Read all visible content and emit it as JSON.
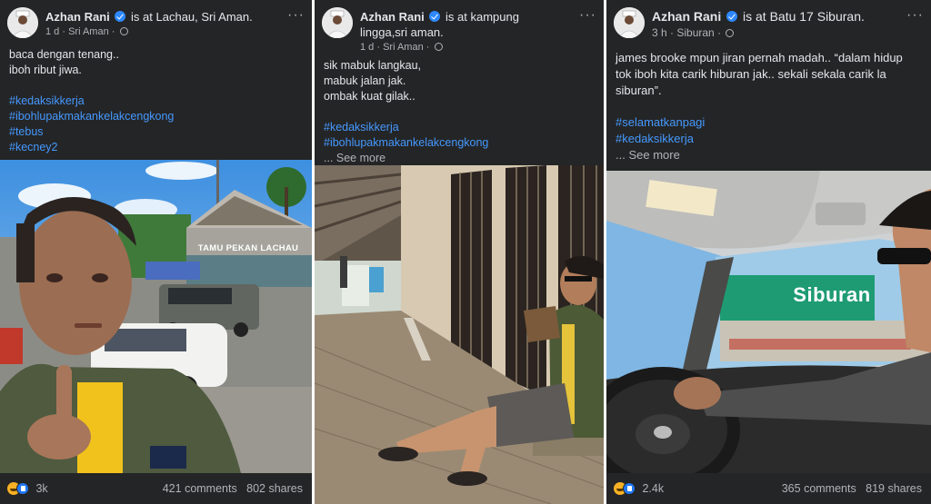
{
  "posts": [
    {
      "author": "Azhan Rani",
      "checkin": "is at Lachau, Sri Aman.",
      "time": "1 d",
      "place": "Sri Aman",
      "lines": [
        "baca dengan tenang..",
        "iboh ribut jiwa."
      ],
      "tags": [
        "#kedaksikkerja",
        "#ibohlupakmakankelakcengkong",
        "#tebus",
        "#kecney2"
      ],
      "see_more": "",
      "photo_sign": "TAMU PEKAN LACHAU",
      "reactions": "3k",
      "comments": "421 comments",
      "shares": "802 shares"
    },
    {
      "author": "Azhan Rani",
      "checkin": "is at kampung lingga,sri aman.",
      "time": "1 d",
      "place": "Sri Aman",
      "lines": [
        "sik mabuk langkau,",
        "mabuk jalan jak.",
        "ombak kuat gilak.."
      ],
      "tags": [
        "#kedaksikkerja",
        "#ibohlupakmakankelakcengkong"
      ],
      "see_more": "... See more",
      "reactions": "",
      "comments": "",
      "shares": ""
    },
    {
      "author": "Azhan Rani",
      "checkin": "is at Batu 17 Siburan.",
      "time": "3 h",
      "place": "Siburan",
      "lines": [
        "james brooke mpun jiran pernah madah.. “dalam hidup",
        "tok iboh kita carik hiburan jak.. sekali sekala carik la",
        "siburan”."
      ],
      "tags": [
        "#selamatkanpagi",
        "#kedaksikkerja"
      ],
      "see_more": "... See more",
      "photo_sign": "Siburan",
      "reactions": "2.4k",
      "comments": "365 comments",
      "shares": "819 shares"
    }
  ],
  "icons": [
    "verified-badge-icon",
    "globe-icon",
    "more-options-icon",
    "haha-reaction-icon",
    "like-reaction-icon"
  ]
}
